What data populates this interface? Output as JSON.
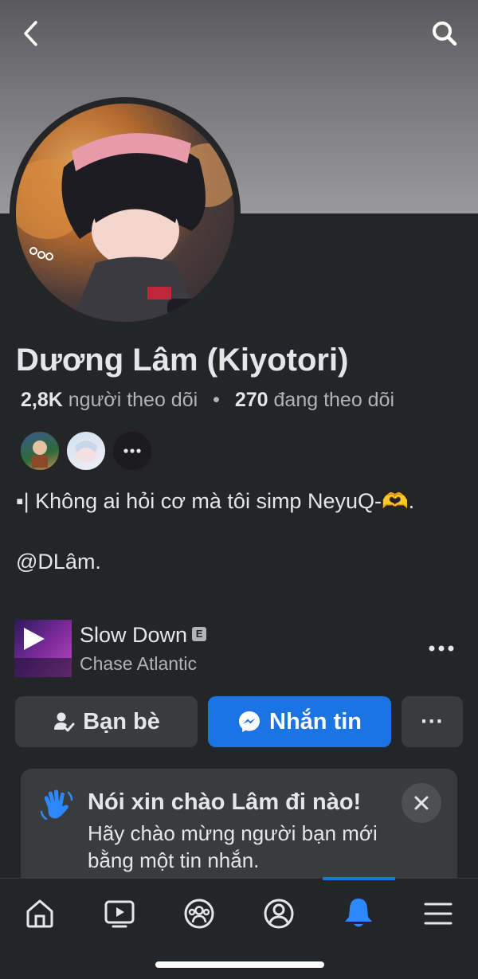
{
  "profile": {
    "name": "Dương Lâm (Kiyotori)",
    "followers_count": "2,8K",
    "followers_label": "người theo dõi",
    "following_count": "270",
    "following_label": "đang theo dõi",
    "bio": "▪| Không ai hỏi cơ mà tôi simp NeyuQ-🫶.\n\n@DLâm."
  },
  "music": {
    "title": "Slow Down",
    "badge": "E",
    "artist": "Chase Atlantic"
  },
  "actions": {
    "friends_label": "Bạn bè",
    "message_label": "Nhắn tin",
    "more_label": "···"
  },
  "hello_card": {
    "title": "Nói xin chào Lâm đi nào!",
    "subtitle": "Hãy chào mừng người bạn mới bằng một tin nhắn."
  },
  "bottom_nav": {
    "items": [
      "home",
      "video",
      "groups",
      "profile",
      "notifications",
      "menu"
    ],
    "active": "notifications"
  },
  "colors": {
    "background": "#242526",
    "accent": "#1b74e4",
    "secondary_button": "#3a3b3c",
    "text_primary": "#e4e6eb",
    "text_secondary": "#b0b3b8"
  }
}
